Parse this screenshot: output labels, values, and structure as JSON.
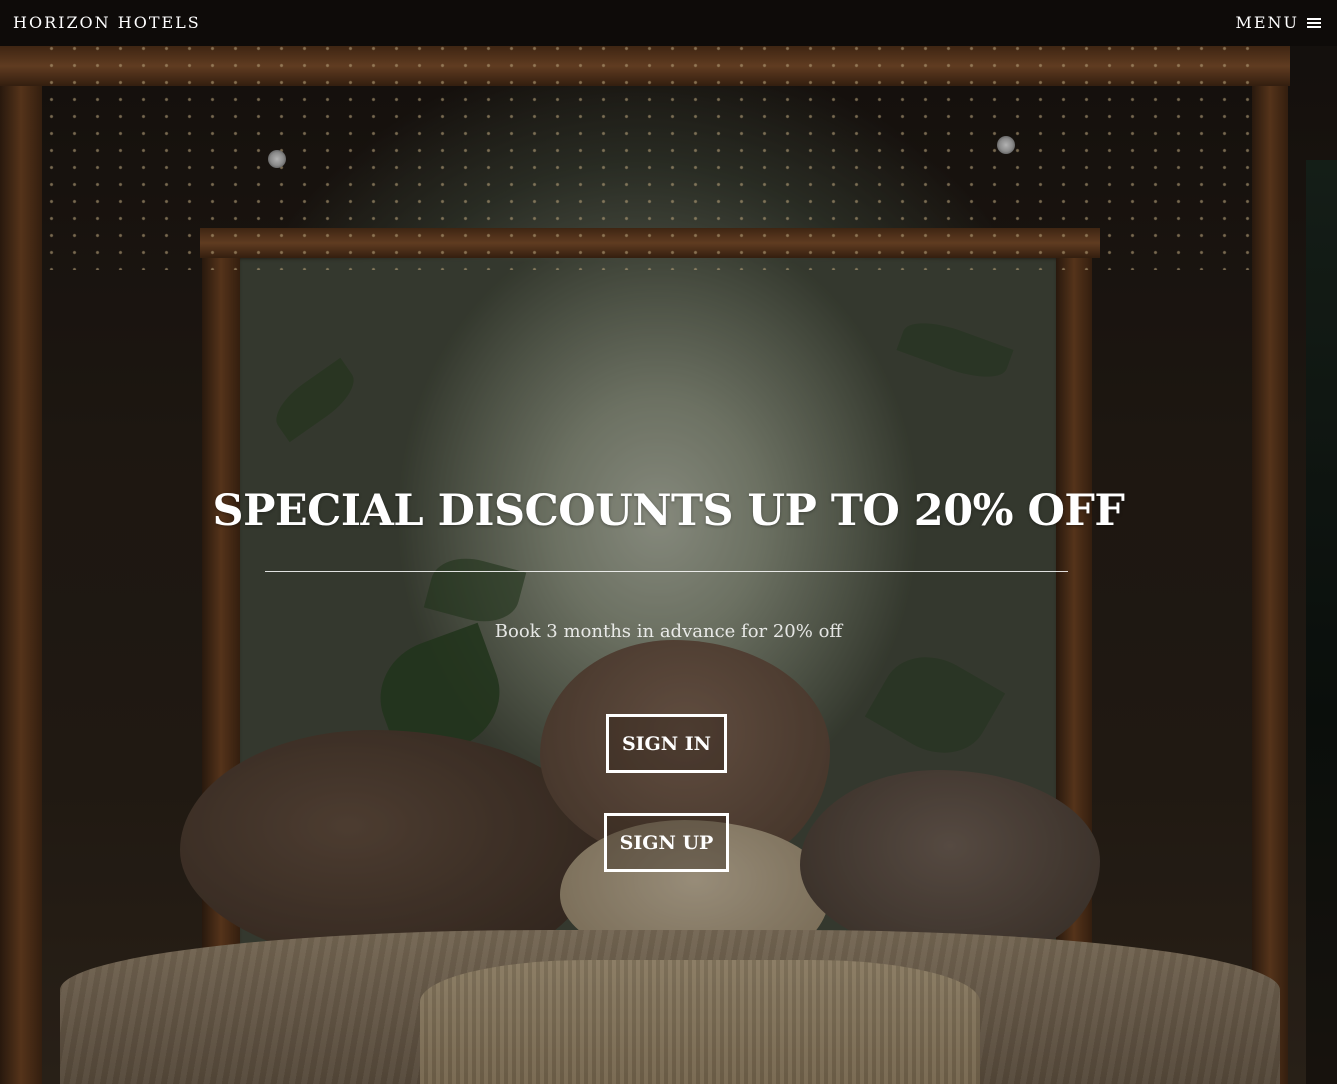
{
  "header": {
    "brand": "HORIZON HOTELS",
    "menu_label": "MENU",
    "menu_icon": "hamburger-icon"
  },
  "hero": {
    "headline": "SPECIAL DISCOUNTS UP TO 20% OFF",
    "subtext": "Book 3 months in advance for 20% off",
    "signin_label": "SIGN IN",
    "signup_label": "SIGN UP",
    "background": "hotel-bedroom-photo"
  },
  "colors": {
    "text": "#ffffff",
    "topbar": "#0e0b09",
    "button_border": "#ffffff"
  }
}
